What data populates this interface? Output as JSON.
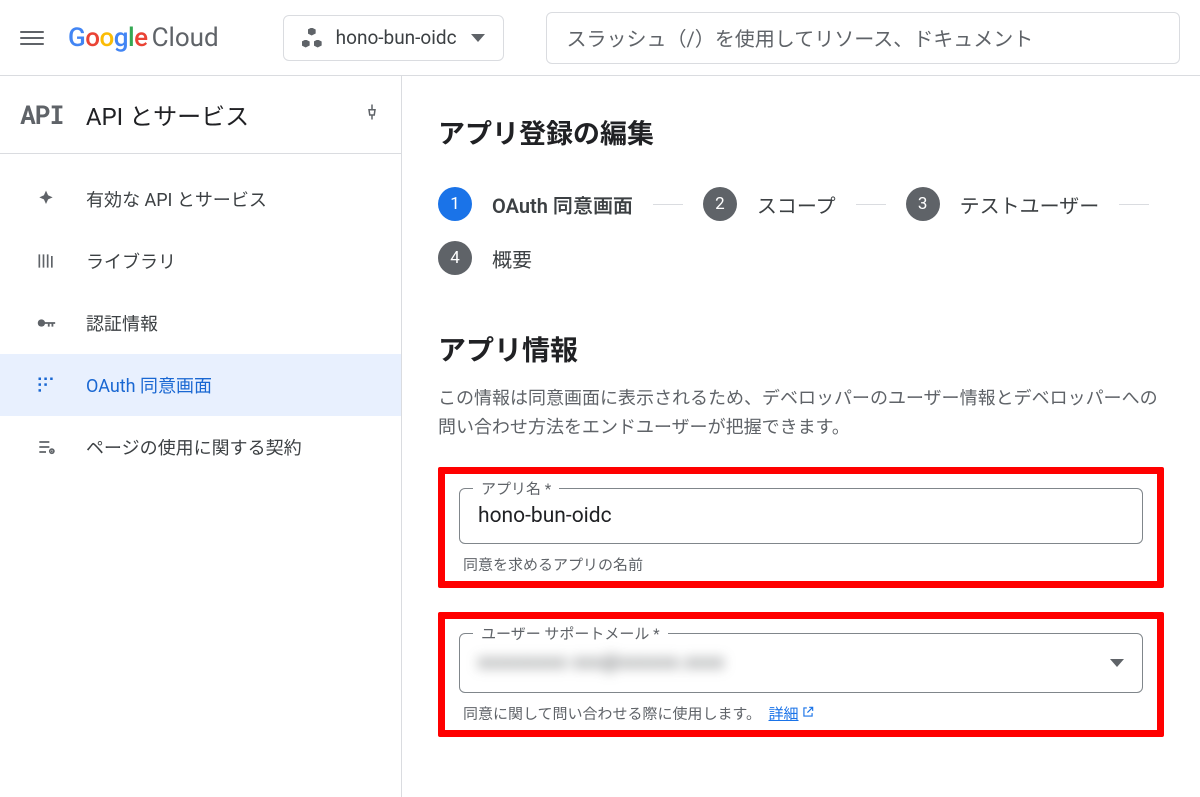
{
  "header": {
    "brand_cloud": "Cloud",
    "project_name": "hono-bun-oidc",
    "search_placeholder": "スラッシュ（/）を使用してリソース、ドキュメント"
  },
  "sidebar": {
    "api_logo": "API",
    "title": "API とサービス",
    "items": [
      {
        "label": "有効な API とサービス",
        "icon": "enabled-apis-icon",
        "active": false
      },
      {
        "label": "ライブラリ",
        "icon": "library-icon",
        "active": false
      },
      {
        "label": "認証情報",
        "icon": "credentials-icon",
        "active": false
      },
      {
        "label": "OAuth 同意画面",
        "icon": "oauth-consent-icon",
        "active": true
      },
      {
        "label": "ページの使用に関する契約",
        "icon": "page-usage-icon",
        "active": false
      }
    ]
  },
  "main": {
    "page_title": "アプリ登録の編集",
    "steps": [
      {
        "num": "1",
        "label": "OAuth 同意画面",
        "active": true
      },
      {
        "num": "2",
        "label": "スコープ",
        "active": false
      },
      {
        "num": "3",
        "label": "テストユーザー",
        "active": false
      },
      {
        "num": "4",
        "label": "概要",
        "active": false
      }
    ],
    "app_info": {
      "section_title": "アプリ情報",
      "section_desc": "この情報は同意画面に表示されるため、デベロッパーのユーザー情報とデベロッパーへの問い合わせ方法をエンドユーザーが把握できます。",
      "app_name_label": "アプリ名 *",
      "app_name_value": "hono-bun-oidc",
      "app_name_helper": "同意を求めるアプリの名前",
      "support_email_label": "ユーザー サポートメール *",
      "support_email_value": "xxxxxxxxx xxx@xxxxxx.xxxx",
      "support_email_helper": "同意に関して問い合わせる際に使用します。",
      "learn_more": "詳細"
    }
  }
}
